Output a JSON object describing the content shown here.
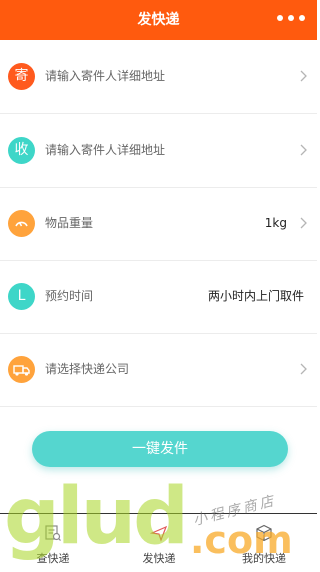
{
  "header": {
    "title": "发快递"
  },
  "rows": [
    {
      "badge": "寄",
      "label": "请输入寄件人详细地址",
      "value": "",
      "badge_color": "#ff5a1e"
    },
    {
      "badge": "收",
      "label": "请输入寄件人详细地址",
      "value": "",
      "badge_color": "#3ed6c8"
    },
    {
      "badge": "",
      "label": "物品重量",
      "value": "1kg",
      "badge_color": "#ffa33c"
    },
    {
      "badge": "L",
      "label": "预约时间",
      "value": "两小时内上门取件",
      "badge_color": "#3ed6c8"
    },
    {
      "badge": "",
      "label": "请选择快递公司",
      "value": "",
      "badge_color": "#ffa33c"
    }
  ],
  "submit_button": {
    "label": "一键发件"
  },
  "tabs": [
    {
      "label": "查快递",
      "icon": "search-list-icon"
    },
    {
      "label": "发快递",
      "icon": "send-icon"
    },
    {
      "label": "我的快递",
      "icon": "box-icon"
    }
  ],
  "watermark": {
    "main": "glud",
    "suffix": ".com",
    "small": "小程序商店"
  }
}
